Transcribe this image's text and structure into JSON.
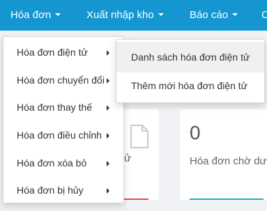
{
  "colors": {
    "brand": "#1596d1",
    "teal": "#1ab5a8",
    "red": "#e04a4a"
  },
  "navbar": {
    "items": [
      {
        "label": "Hóa đơn",
        "icon": "caret-down-icon"
      },
      {
        "label": "Xuất nhập kho",
        "icon": "caret-down-icon"
      },
      {
        "label": "Báo cáo",
        "icon": "caret-down-icon"
      },
      {
        "label": "C",
        "icon": ""
      }
    ]
  },
  "dropdown": {
    "items": [
      {
        "label": "Hóa đơn điện tử",
        "icon": "chevron-right-icon"
      },
      {
        "label": "Hóa đơn chuyển đổi",
        "icon": "chevron-right-icon"
      },
      {
        "label": "Hóa đơn thay thế",
        "icon": "chevron-right-icon"
      },
      {
        "label": "Hóa đơn điều chỉnh",
        "icon": "chevron-right-icon"
      },
      {
        "label": "Hóa đơn xóa bỏ",
        "icon": "chevron-right-icon"
      },
      {
        "label": "Hóa đơn bị hủy",
        "icon": "chevron-right-icon"
      }
    ]
  },
  "submenu": {
    "items": [
      {
        "label": "Danh sách hóa đơn điện tử",
        "hovered": true
      },
      {
        "label": "Thêm mới hóa đơn điện tử",
        "hovered": false
      }
    ]
  },
  "cards": {
    "left": {
      "label_fragment": "ử",
      "icon": "document-icon"
    },
    "right": {
      "value": "0",
      "label": "Hóa đơn chờ dư"
    }
  }
}
